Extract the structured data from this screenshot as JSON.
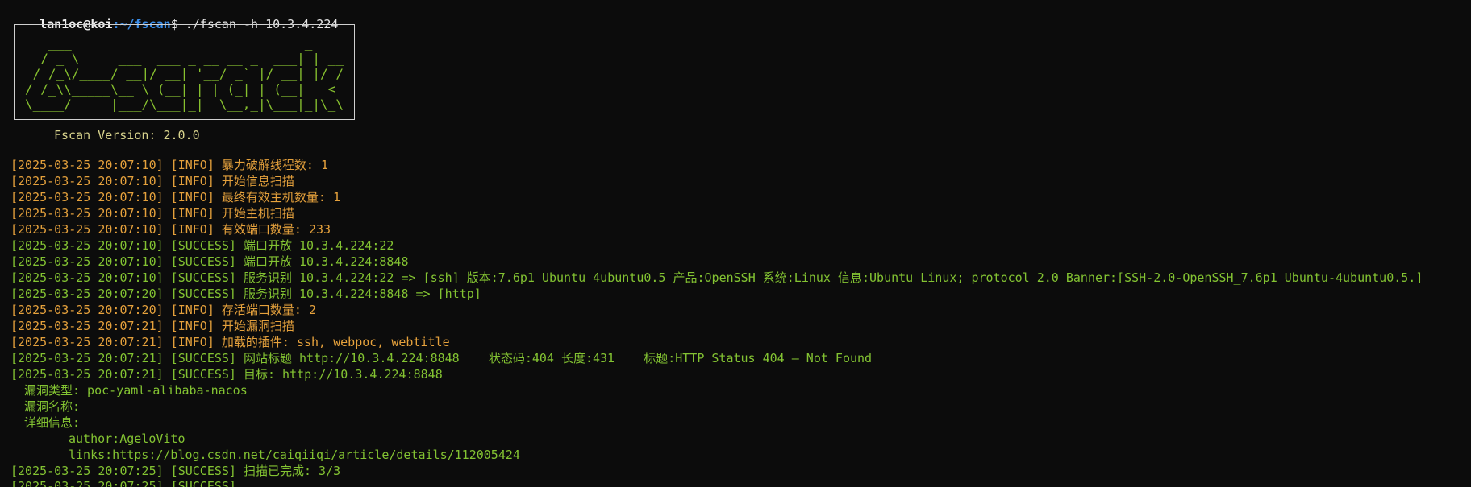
{
  "prompt": {
    "user_host": "lan1oc@koi",
    "path": ":~/fscan",
    "symbol": "$",
    "command": " ./fscan -h 10.3.4.224"
  },
  "banner": {
    "art": "   ___                              _    \n  / _ \\     ___  ___ _ __ __ _  ___| | __\n / /_\\/____/ __|/ __| '__/ _` |/ __| |/ /\n/ /_\\\\_____\\__ \\ (__| | | (_| | (__|   < \n\\____/     |___/\\___|_|  \\__,_|\\___|_|\\_\\",
    "version": "Fscan Version: 2.0.0"
  },
  "logs": [
    {
      "level": "info",
      "text": "[2025-03-25 20:07:10] [INFO] 暴力破解线程数: 1"
    },
    {
      "level": "info",
      "text": "[2025-03-25 20:07:10] [INFO] 开始信息扫描"
    },
    {
      "level": "info",
      "text": "[2025-03-25 20:07:10] [INFO] 最终有效主机数量: 1"
    },
    {
      "level": "info",
      "text": "[2025-03-25 20:07:10] [INFO] 开始主机扫描"
    },
    {
      "level": "info",
      "text": "[2025-03-25 20:07:10] [INFO] 有效端口数量: 233"
    },
    {
      "level": "success",
      "text": "[2025-03-25 20:07:10] [SUCCESS] 端口开放 10.3.4.224:22"
    },
    {
      "level": "success",
      "text": "[2025-03-25 20:07:10] [SUCCESS] 端口开放 10.3.4.224:8848"
    },
    {
      "level": "success",
      "text": "[2025-03-25 20:07:10] [SUCCESS] 服务识别 10.3.4.224:22 => [ssh] 版本:7.6p1 Ubuntu 4ubuntu0.5 产品:OpenSSH 系统:Linux 信息:Ubuntu Linux; protocol 2.0 Banner:[SSH-2.0-OpenSSH_7.6p1 Ubuntu-4ubuntu0.5.]"
    },
    {
      "level": "success",
      "text": "[2025-03-25 20:07:20] [SUCCESS] 服务识别 10.3.4.224:8848 => [http]"
    },
    {
      "level": "info",
      "text": "[2025-03-25 20:07:20] [INFO] 存活端口数量: 2"
    },
    {
      "level": "info",
      "text": "[2025-03-25 20:07:21] [INFO] 开始漏洞扫描"
    },
    {
      "level": "info",
      "text": "[2025-03-25 20:07:21] [INFO] 加载的插件: ssh, webpoc, webtitle"
    },
    {
      "level": "success",
      "text": "[2025-03-25 20:07:21] [SUCCESS] 网站标题 http://10.3.4.224:8848    状态码:404 长度:431    标题:HTTP Status 404 – Not Found"
    },
    {
      "level": "success",
      "text": "[2025-03-25 20:07:21] [SUCCESS] 目标: http://10.3.4.224:8848"
    }
  ],
  "vuln": {
    "type_line": "漏洞类型: poc-yaml-alibaba-nacos",
    "name_line": "漏洞名称:",
    "detail_line": "详细信息:",
    "author_line": "author:AgeloVito",
    "links_line": "links:https://blog.csdn.net/caiqiiqi/article/details/112005424"
  },
  "final_log": {
    "level": "success",
    "text": "[2025-03-25 20:07:25] [SUCCESS] 扫描已完成: 3/3"
  },
  "partial_line": "[2025-03-25 20:07:25] [SUCCESS]"
}
